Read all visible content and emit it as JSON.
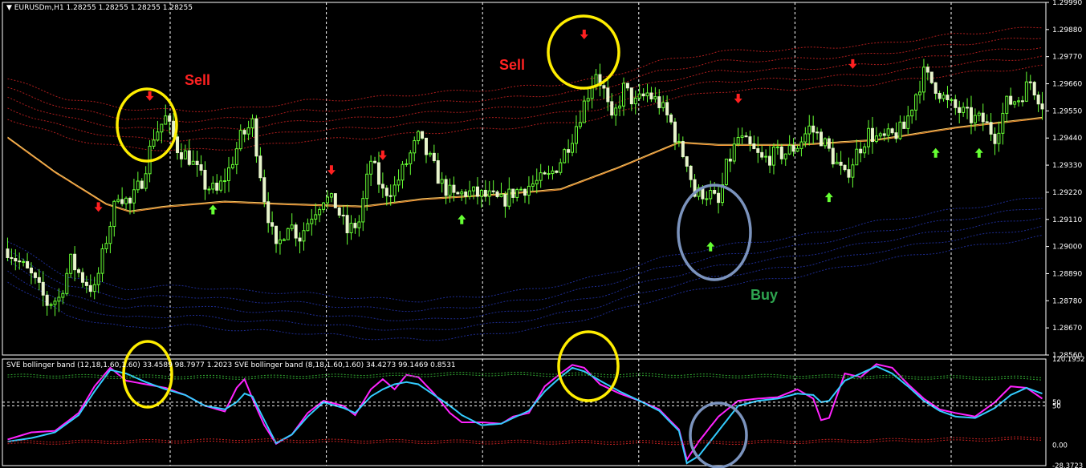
{
  "header": {
    "symbol_text": "EURUSDm,H1  1.28255 1.28255 1.28255 1.28255",
    "indicator_text": "SVE bollinger band (12,18,1.60,1.60) 33.4589 98.7977 1.2023  SVE bollinger band (8,18,1.60,1.60) 34.4273 99.1469 0.8531"
  },
  "annotations": {
    "sell_1": "Sell",
    "sell_2": "Sell",
    "buy": "Buy"
  },
  "colors": {
    "background": "#000000",
    "bull_candle": "#66ff33",
    "bear_candle": "#e8f5cc",
    "moving_average": "#ff9933",
    "upper_bands": "#cc2222",
    "lower_bands": "#2233aa",
    "sell_arrow": "#ff2020",
    "buy_arrow": "#66ff33",
    "osc_magenta": "#ff22ff",
    "osc_cyan": "#33ccff",
    "osc_upper": "#33aa33",
    "osc_lower": "#cc2222",
    "highlight_yellow": "#ffee00",
    "highlight_blue": "#7b93bd",
    "sell_label": "#ff2222",
    "buy_label": "#2ea44f"
  },
  "chart_data": [
    {
      "type": "candlestick",
      "panel": "main",
      "instrument": "EURUSDm",
      "timeframe": "H1",
      "ylim": [
        1.2856,
        1.2999
      ],
      "y_ticks": [
        "1.29990",
        "1.29880",
        "1.29770",
        "1.29660",
        "1.29550",
        "1.29440",
        "1.29330",
        "1.29220",
        "1.29110",
        "1.29000",
        "1.28890",
        "1.28780",
        "1.28670",
        "1.28560"
      ],
      "close_anchors": [
        [
          0,
          1.2899
        ],
        [
          6,
          1.2888
        ],
        [
          10,
          1.2877
        ],
        [
          13,
          1.2879
        ],
        [
          16,
          1.2894
        ],
        [
          19,
          1.2887
        ],
        [
          22,
          1.2882
        ],
        [
          25,
          1.2903
        ],
        [
          28,
          1.2922
        ],
        [
          31,
          1.2917
        ],
        [
          34,
          1.2927
        ],
        [
          37,
          1.2945
        ],
        [
          40,
          1.2952
        ],
        [
          43,
          1.294
        ],
        [
          46,
          1.2936
        ],
        [
          50,
          1.2925
        ],
        [
          53,
          1.2922
        ],
        [
          56,
          1.2931
        ],
        [
          59,
          1.2944
        ],
        [
          62,
          1.295
        ],
        [
          65,
          1.292
        ],
        [
          68,
          1.2898
        ],
        [
          71,
          1.291
        ],
        [
          74,
          1.2904
        ],
        [
          77,
          1.2913
        ],
        [
          80,
          1.292
        ],
        [
          83,
          1.2917
        ],
        [
          86,
          1.2906
        ],
        [
          89,
          1.291
        ],
        [
          92,
          1.2935
        ],
        [
          95,
          1.2922
        ],
        [
          98,
          1.2924
        ],
        [
          101,
          1.2934
        ],
        [
          104,
          1.2944
        ],
        [
          107,
          1.2935
        ],
        [
          110,
          1.2925
        ],
        [
          113,
          1.292
        ],
        [
          116,
          1.2922
        ],
        [
          119,
          1.2921
        ],
        [
          122,
          1.292
        ],
        [
          125,
          1.2918
        ],
        [
          128,
          1.2922
        ],
        [
          131,
          1.2924
        ],
        [
          134,
          1.2926
        ],
        [
          137,
          1.2928
        ],
        [
          140,
          1.2935
        ],
        [
          143,
          1.2945
        ],
        [
          146,
          1.2958
        ],
        [
          149,
          1.2971
        ],
        [
          151,
          1.2963
        ],
        [
          153,
          1.295
        ],
        [
          156,
          1.2964
        ],
        [
          159,
          1.2958
        ],
        [
          162,
          1.2962
        ],
        [
          165,
          1.2958
        ],
        [
          168,
          1.295
        ],
        [
          170,
          1.294
        ],
        [
          172,
          1.2935
        ],
        [
          174,
          1.2921
        ],
        [
          176,
          1.2922
        ],
        [
          178,
          1.2921
        ],
        [
          180,
          1.2917
        ],
        [
          182,
          1.2932
        ],
        [
          185,
          1.2944
        ],
        [
          188,
          1.294
        ],
        [
          191,
          1.2935
        ],
        [
          194,
          1.2937
        ],
        [
          197,
          1.2938
        ],
        [
          200,
          1.2941
        ],
        [
          203,
          1.2948
        ],
        [
          206,
          1.2944
        ],
        [
          209,
          1.2936
        ],
        [
          212,
          1.2928
        ],
        [
          215,
          1.2938
        ],
        [
          218,
          1.2946
        ],
        [
          221,
          1.2943
        ],
        [
          224,
          1.2945
        ],
        [
          227,
          1.2948
        ],
        [
          230,
          1.2962
        ],
        [
          232,
          1.297
        ],
        [
          235,
          1.2965
        ],
        [
          238,
          1.2958
        ],
        [
          241,
          1.2955
        ],
        [
          244,
          1.2952
        ],
        [
          247,
          1.2951
        ],
        [
          250,
          1.2945
        ],
        [
          253,
          1.2958
        ],
        [
          256,
          1.296
        ],
        [
          259,
          1.2967
        ],
        [
          262,
          1.2958
        ]
      ],
      "moving_average_anchors": [
        [
          0,
          1.2944
        ],
        [
          12,
          1.293
        ],
        [
          25,
          1.2917
        ],
        [
          31,
          1.2914
        ],
        [
          40,
          1.2916
        ],
        [
          55,
          1.2918
        ],
        [
          70,
          1.2917
        ],
        [
          90,
          1.2916
        ],
        [
          105,
          1.2919
        ],
        [
          125,
          1.2921
        ],
        [
          140,
          1.2923
        ],
        [
          155,
          1.2932
        ],
        [
          170,
          1.2942
        ],
        [
          180,
          1.2941
        ],
        [
          200,
          1.2941
        ],
        [
          220,
          1.2943
        ],
        [
          240,
          1.2948
        ],
        [
          262,
          1.2952
        ]
      ],
      "upper_band_anchors": [
        [
          0,
          1.2968
        ],
        [
          15,
          1.296
        ],
        [
          30,
          1.2956
        ],
        [
          45,
          1.2955
        ],
        [
          60,
          1.2956
        ],
        [
          75,
          1.2959
        ],
        [
          90,
          1.296
        ],
        [
          105,
          1.2962
        ],
        [
          125,
          1.2964
        ],
        [
          140,
          1.2966
        ],
        [
          150,
          1.2968
        ],
        [
          165,
          1.2975
        ],
        [
          180,
          1.2979
        ],
        [
          200,
          1.298
        ],
        [
          220,
          1.2982
        ],
        [
          240,
          1.2986
        ],
        [
          262,
          1.2989
        ]
      ],
      "upper_band_offsets": [
        0,
        -0.0004,
        -0.0008,
        -0.0012,
        -0.0016
      ],
      "lower_band_anchors": [
        [
          0,
          1.2902
        ],
        [
          15,
          1.2888
        ],
        [
          30,
          1.2883
        ],
        [
          45,
          1.2884
        ],
        [
          60,
          1.2882
        ],
        [
          75,
          1.2881
        ],
        [
          90,
          1.2879
        ],
        [
          105,
          1.2878
        ],
        [
          120,
          1.288
        ],
        [
          135,
          1.2883
        ],
        [
          150,
          1.2888
        ],
        [
          165,
          1.2895
        ],
        [
          180,
          1.29
        ],
        [
          200,
          1.2904
        ],
        [
          220,
          1.291
        ],
        [
          240,
          1.2915
        ],
        [
          262,
          1.292
        ]
      ],
      "lower_band_offsets": [
        0,
        -0.0004,
        -0.0008,
        -0.0012,
        -0.0016
      ],
      "sell_arrows": [
        [
          23,
          1.2916
        ],
        [
          36,
          1.2961
        ],
        [
          82,
          1.2931
        ],
        [
          95,
          1.2937
        ],
        [
          146,
          1.2986
        ],
        [
          185,
          1.296
        ],
        [
          214,
          1.2974
        ]
      ],
      "buy_arrows": [
        [
          52,
          1.2915
        ],
        [
          115,
          1.2911
        ],
        [
          178,
          1.29
        ],
        [
          208,
          1.292
        ],
        [
          235,
          1.2938
        ],
        [
          246,
          1.2938
        ]
      ]
    },
    {
      "type": "line",
      "panel": "oscillator",
      "ylim": [
        -28.3723,
        120.1952
      ],
      "y_ticks": [
        "120.1952",
        "50",
        "50",
        "0.00",
        "-28.3723"
      ],
      "series": [
        {
          "color": "magenta",
          "anchors": [
            [
              0,
              8
            ],
            [
              6,
              18
            ],
            [
              12,
              20
            ],
            [
              18,
              45
            ],
            [
              22,
              82
            ],
            [
              26,
              108
            ],
            [
              30,
              90
            ],
            [
              35,
              85
            ],
            [
              40,
              80
            ],
            [
              45,
              70
            ],
            [
              50,
              55
            ],
            [
              55,
              47
            ],
            [
              58,
              80
            ],
            [
              60,
              92
            ],
            [
              62,
              65
            ],
            [
              65,
              28
            ],
            [
              68,
              2
            ],
            [
              72,
              15
            ],
            [
              76,
              45
            ],
            [
              80,
              62
            ],
            [
              85,
              55
            ],
            [
              88,
              42
            ],
            [
              92,
              78
            ],
            [
              95,
              92
            ],
            [
              98,
              78
            ],
            [
              101,
              98
            ],
            [
              104,
              95
            ],
            [
              108,
              72
            ],
            [
              112,
              45
            ],
            [
              115,
              32
            ],
            [
              120,
              32
            ],
            [
              125,
              30
            ],
            [
              128,
              40
            ],
            [
              132,
              45
            ],
            [
              136,
              82
            ],
            [
              140,
              100
            ],
            [
              143,
              112
            ],
            [
              146,
              108
            ],
            [
              150,
              85
            ],
            [
              155,
              72
            ],
            [
              160,
              62
            ],
            [
              165,
              50
            ],
            [
              170,
              22
            ],
            [
              172,
              -20
            ],
            [
              175,
              5
            ],
            [
              180,
              40
            ],
            [
              185,
              62
            ],
            [
              190,
              65
            ],
            [
              195,
              67
            ],
            [
              200,
              78
            ],
            [
              204,
              65
            ],
            [
              206,
              35
            ],
            [
              208,
              38
            ],
            [
              212,
              100
            ],
            [
              216,
              95
            ],
            [
              220,
              113
            ],
            [
              224,
              108
            ],
            [
              228,
              85
            ],
            [
              232,
              65
            ],
            [
              236,
              50
            ],
            [
              240,
              45
            ],
            [
              245,
              40
            ],
            [
              250,
              60
            ],
            [
              254,
              82
            ],
            [
              258,
              80
            ],
            [
              262,
              65
            ]
          ]
        },
        {
          "color": "cyan",
          "anchors": [
            [
              0,
              5
            ],
            [
              6,
              10
            ],
            [
              12,
              18
            ],
            [
              18,
              42
            ],
            [
              22,
              75
            ],
            [
              26,
              105
            ],
            [
              30,
              100
            ],
            [
              35,
              88
            ],
            [
              40,
              78
            ],
            [
              45,
              70
            ],
            [
              50,
              55
            ],
            [
              55,
              50
            ],
            [
              58,
              60
            ],
            [
              60,
              72
            ],
            [
              62,
              68
            ],
            [
              65,
              35
            ],
            [
              68,
              3
            ],
            [
              72,
              15
            ],
            [
              76,
              40
            ],
            [
              80,
              60
            ],
            [
              85,
              52
            ],
            [
              88,
              45
            ],
            [
              92,
              68
            ],
            [
              95,
              78
            ],
            [
              98,
              85
            ],
            [
              101,
              88
            ],
            [
              104,
              85
            ],
            [
              108,
              70
            ],
            [
              112,
              55
            ],
            [
              115,
              42
            ],
            [
              120,
              28
            ],
            [
              125,
              30
            ],
            [
              128,
              38
            ],
            [
              132,
              48
            ],
            [
              136,
              75
            ],
            [
              140,
              95
            ],
            [
              143,
              108
            ],
            [
              146,
              103
            ],
            [
              150,
              90
            ],
            [
              155,
              75
            ],
            [
              160,
              62
            ],
            [
              165,
              48
            ],
            [
              170,
              20
            ],
            [
              172,
              -25
            ],
            [
              175,
              -15
            ],
            [
              180,
              20
            ],
            [
              185,
              55
            ],
            [
              190,
              62
            ],
            [
              195,
              65
            ],
            [
              200,
              72
            ],
            [
              204,
              70
            ],
            [
              206,
              60
            ],
            [
              208,
              62
            ],
            [
              212,
              90
            ],
            [
              216,
              100
            ],
            [
              220,
              110
            ],
            [
              224,
              100
            ],
            [
              228,
              82
            ],
            [
              232,
              62
            ],
            [
              236,
              48
            ],
            [
              240,
              40
            ],
            [
              245,
              38
            ],
            [
              250,
              52
            ],
            [
              254,
              70
            ],
            [
              258,
              80
            ],
            [
              262,
              72
            ]
          ]
        },
        {
          "color": "green-dotted",
          "anchors": [
            [
              0,
              95
            ],
            [
              60,
              93
            ],
            [
              120,
              98
            ],
            [
              180,
              95
            ],
            [
              262,
              92
            ]
          ]
        },
        {
          "color": "red-dotted",
          "anchors": [
            [
              0,
              2
            ],
            [
              60,
              5
            ],
            [
              120,
              3
            ],
            [
              180,
              2
            ],
            [
              262,
              8
            ]
          ]
        }
      ],
      "reference_levels": [
        60,
        55
      ]
    }
  ]
}
